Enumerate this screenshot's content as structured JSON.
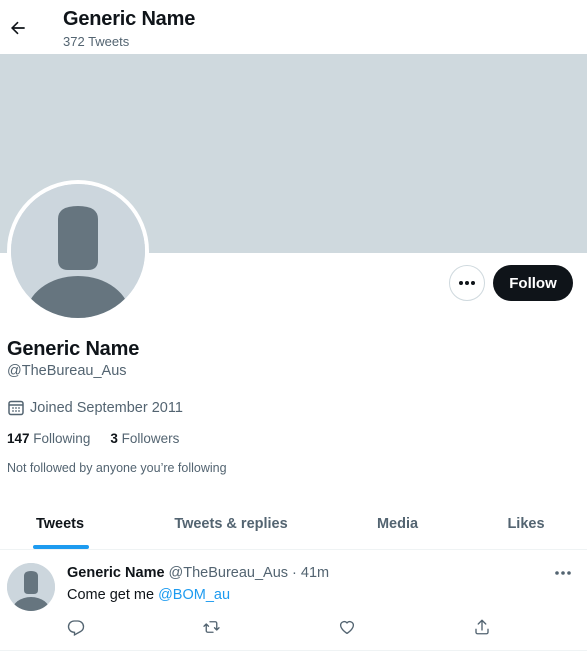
{
  "header": {
    "back_icon": "arrow-left-icon",
    "title": "Generic Name",
    "subtitle": "372 Tweets"
  },
  "colors": {
    "banner": "#cfd9de",
    "follow_button_bg": "#0f1419",
    "accent": "#1d9bf0",
    "secondary_text": "#536471"
  },
  "profile": {
    "more_icon": "more-horizontal-icon",
    "follow_label": "Follow",
    "name": "Generic Name",
    "handle": "@TheBureau_Aus",
    "joined_icon": "calendar-icon",
    "joined": "Joined September 2011",
    "following_count": "147",
    "following_label": "Following",
    "followers_count": "3",
    "followers_label": "Followers",
    "not_followed": "Not followed by anyone you’re following"
  },
  "tabs": [
    {
      "label": "Tweets",
      "active": true
    },
    {
      "label": "Tweets & replies",
      "active": false
    },
    {
      "label": "Media",
      "active": false
    },
    {
      "label": "Likes",
      "active": false
    }
  ],
  "tweet": {
    "name": "Generic Name",
    "handle": "@TheBureau_Aus",
    "separator": "·",
    "time": "41m",
    "text": "Come get me",
    "mention": "@BOM_au",
    "actions": [
      "reply-icon",
      "retweet-icon",
      "like-icon",
      "share-icon"
    ]
  }
}
